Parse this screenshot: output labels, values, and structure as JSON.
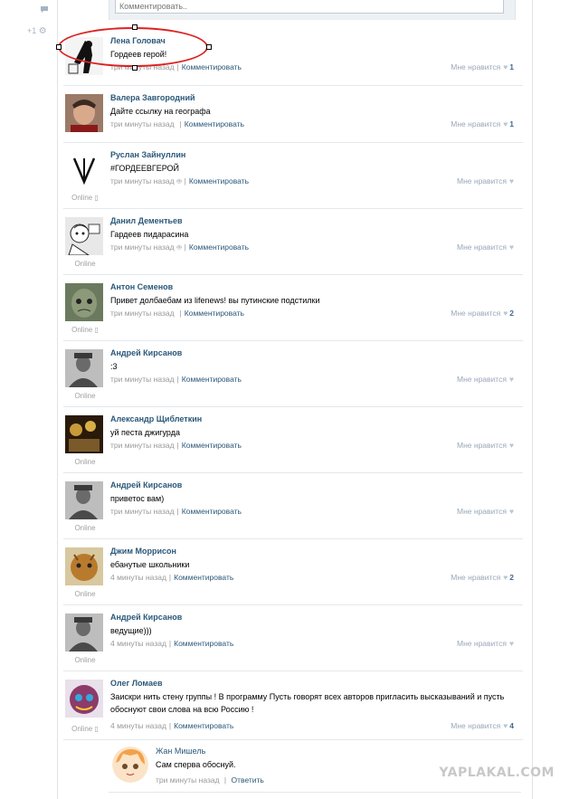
{
  "gutter": {
    "counter": "+1"
  },
  "comment_input": {
    "placeholder": "Комментировать.."
  },
  "labels": {
    "comment": "Комментировать",
    "like": "Мне нравится",
    "reply": "Ответить",
    "online": "Online"
  },
  "posts": [
    {
      "author": "Лена Головач",
      "text": "Гордеев герой!",
      "time": "три минуты назад",
      "device": "",
      "likes": "1",
      "online": false,
      "avatar_color": "#f4f4f4"
    },
    {
      "author": "Валера Завгородний",
      "text": "Дайте ссылку на географа",
      "time": "три минуты назад",
      "device": "apple",
      "likes": "1",
      "online": false,
      "avatar_color": "#9b7a68"
    },
    {
      "author": "Руслан Зайнуллин",
      "text": "#ГОРДЕЕВГЕРОЙ",
      "time": "три минуты назад",
      "device": "android",
      "likes": "",
      "online": true,
      "avatar_color": "#ffffff"
    },
    {
      "author": "Данил Дементьев",
      "text": "Гардеев пидарасина",
      "time": "три минуты назад",
      "device": "android",
      "likes": "",
      "online": true,
      "avatar_color": "#e8e8e8"
    },
    {
      "author": "Антон Семенов",
      "text": "Привет долбаебам из lifenews! вы путинские подстилки",
      "time": "три минуты назад",
      "device": "apple",
      "likes": "2",
      "online": true,
      "avatar_color": "#6b7a5e"
    },
    {
      "author": "Андрей Кирсанов",
      "text": ":3",
      "time": "три минуты назад",
      "device": "",
      "likes": "",
      "online": true,
      "avatar_color": "#7d7d7d"
    },
    {
      "author": "Александр Щиблеткин",
      "text": "уй песта джигурда",
      "time": "три минуты назад",
      "device": "",
      "likes": "",
      "online": true,
      "avatar_color": "#8a6a2a"
    },
    {
      "author": "Андрей Кирсанов",
      "text": "приветос вам)",
      "time": "три минуты назад",
      "device": "",
      "likes": "",
      "online": true,
      "avatar_color": "#7d7d7d"
    },
    {
      "author": "Джим Моррисон",
      "text": "ебанутые школьники",
      "time": "4 минуты назад",
      "device": "",
      "likes": "2",
      "online": true,
      "avatar_color": "#b87b2e"
    },
    {
      "author": "Андрей Кирсанов",
      "text": "ведущие)))",
      "time": "4 минуты назад",
      "device": "",
      "likes": "",
      "online": true,
      "avatar_color": "#7d7d7d"
    },
    {
      "author": "Олег Ломаев",
      "text": "Заискри нить стену группы ! В программу Пусть говорят всех авторов пригласить высказываний и пусть обоснуют свои слова на всю Россию !",
      "time": "4 минуты назад",
      "device": "",
      "likes": "4",
      "online": true,
      "avatar_color": "#8c3b6a"
    }
  ],
  "reply": {
    "author": "Жан Мишель",
    "text": "Сам сперва обоснуй.",
    "time": "три минуты назад",
    "avatar_color": "#f2b26b"
  },
  "watermark": "YAPLAKAL.COM"
}
